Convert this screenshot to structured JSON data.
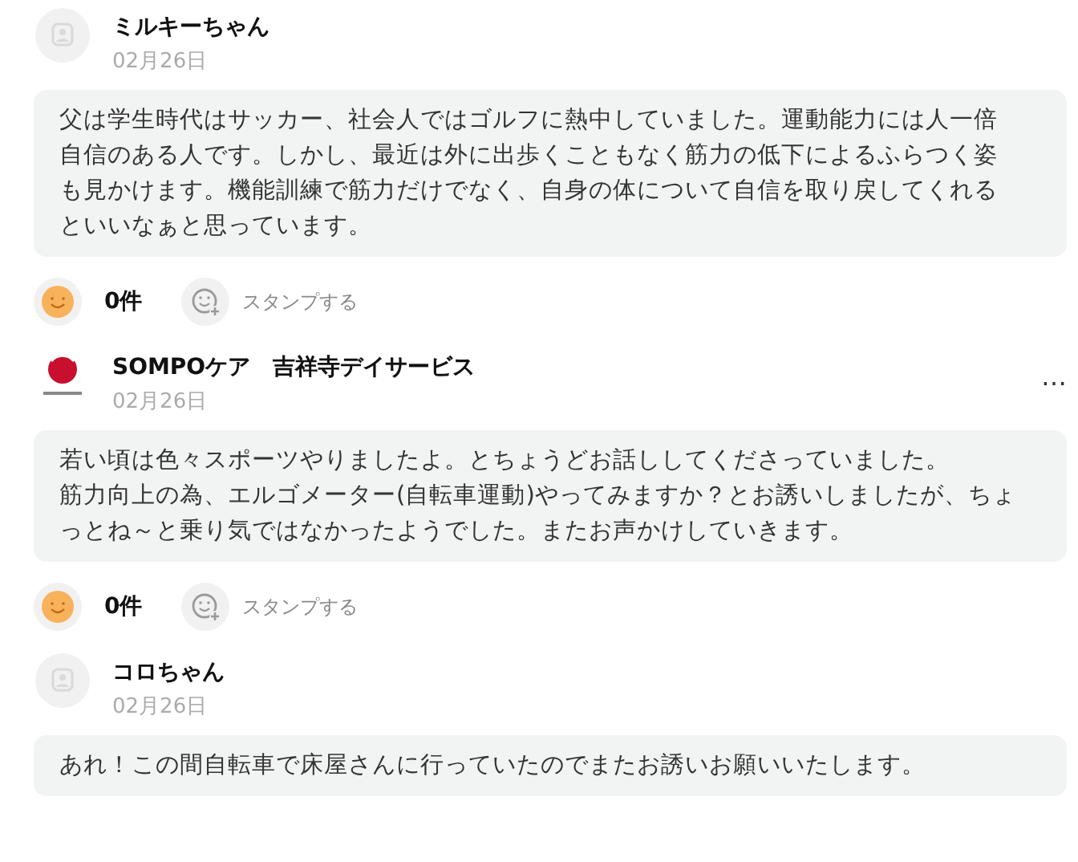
{
  "posts": [
    {
      "kind": "member",
      "author": "ミルキーちゃん",
      "date": "02月26日",
      "body": [
        "父は学生時代はサッカー、社会人ではゴルフに熱中していました。運動能力には人一倍自信のある人です。しかし、最近は外に出歩くこともなく筋力の低下によるふらつく姿も見かけます。機能訓練で筋力だけでなく、自身の体について自信を取り戻してくれるといいなぁと思っています。"
      ],
      "reactions": {
        "count": "0件",
        "stamp": "スタンプする"
      }
    },
    {
      "kind": "facility",
      "author": "SOMPOケア　吉祥寺デイサービス",
      "date": "02月26日",
      "menu": "…",
      "body": [
        "若い頃は色々スポーツやりましたよ。とちょうどお話ししてくださっていました。",
        "筋力向上の為、エルゴメーター(自転車運動)やってみますか？とお誘いしましたが、ちょっとね～と乗り気ではなかったようでした。またお声かけしていきます。"
      ],
      "reactions": {
        "count": "0件",
        "stamp": "スタンプする"
      }
    },
    {
      "kind": "member",
      "author": "コロちゃん",
      "date": "02月26日",
      "body": [
        "あれ！この間自転車で床屋さんに行っていたのでまたお誘いお願いいたします。"
      ]
    }
  ]
}
